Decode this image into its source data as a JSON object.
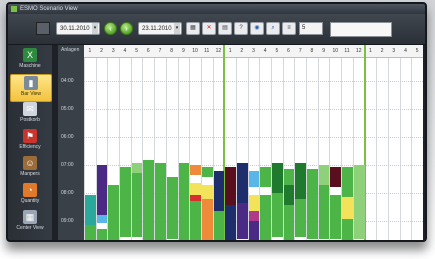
{
  "window": {
    "title": "ESMO Scenario View"
  },
  "toolbar": {
    "date_from": "30.11.2010",
    "date_to": "23.11.2010",
    "filter_value": "5",
    "icons": [
      "calendar-icon",
      "red-x-icon",
      "calendar-grid-icon",
      "help-icon",
      "eye-icon",
      "zoom-icon",
      "list-icon"
    ]
  },
  "sidebar": {
    "items": [
      {
        "label": "Maschine",
        "icon": "excel-icon",
        "color": "#2d8a3e"
      },
      {
        "label": "Bar View",
        "icon": "barchart-icon",
        "color": "#7a8a99",
        "active": true
      },
      {
        "label": "Postkorb",
        "icon": "mail-icon",
        "color": "#cfd6de"
      },
      {
        "label": "Efficiency",
        "icon": "flag-icon",
        "color": "#c9342c"
      },
      {
        "label": "Manpers",
        "icon": "people-icon",
        "color": "#9b6b3a"
      },
      {
        "label": "Quantity",
        "icon": "pie-icon",
        "color": "#e0792a"
      },
      {
        "label": "Center View",
        "icon": "table-icon",
        "color": "#9aa6b3"
      }
    ]
  },
  "grid": {
    "header_label": "Anlagen",
    "columns": [
      "1",
      "2",
      "3",
      "4",
      "5",
      "6",
      "7",
      "8",
      "9",
      "10",
      "11",
      "12",
      "1",
      "2",
      "3",
      "4",
      "5",
      "6",
      "7",
      "8",
      "9",
      "10",
      "11",
      "12",
      "1",
      "2",
      "3",
      "4",
      "5"
    ],
    "time_labels": [
      "04:00",
      "05:00",
      "06:00",
      "07:00",
      "08:00",
      "09:00",
      "10:00"
    ],
    "colors": {
      "green": "#4db548",
      "lightgreen": "#8fd07a",
      "darkgreen": "#1f7a2e",
      "purple": "#4b2a86",
      "navy": "#1e2d6b",
      "maroon": "#5a0f1e",
      "orange": "#ef8a3a",
      "yellow": "#f2e35a",
      "skyblue": "#5ab6e6",
      "red": "#d62f2f",
      "white": "#ffffff",
      "teal": "#2aa89a",
      "magenta": "#b03a8a"
    }
  }
}
